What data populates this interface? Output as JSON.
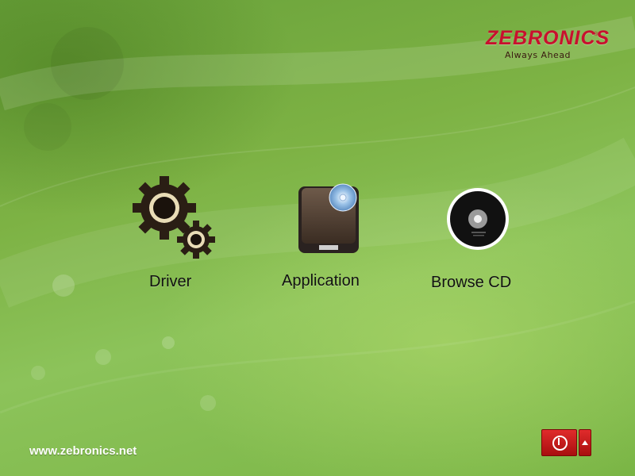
{
  "brand": {
    "name": "ZEBRONICS",
    "tagline": "Always Ahead",
    "registered_mark": "®",
    "color": "#c8102e"
  },
  "menu": [
    {
      "id": "driver",
      "label": "Driver",
      "icon": "gears-icon"
    },
    {
      "id": "application",
      "label": "Application",
      "icon": "drive-disc-icon"
    },
    {
      "id": "browse",
      "label": "Browse CD",
      "icon": "cd-icon"
    }
  ],
  "footer": {
    "website": "www.zebronics.net"
  },
  "controls": {
    "power_icon": "power-icon",
    "menu_icon": "arrow-up-icon",
    "accent": "#d42020"
  },
  "background": {
    "primary": "#7db244"
  }
}
